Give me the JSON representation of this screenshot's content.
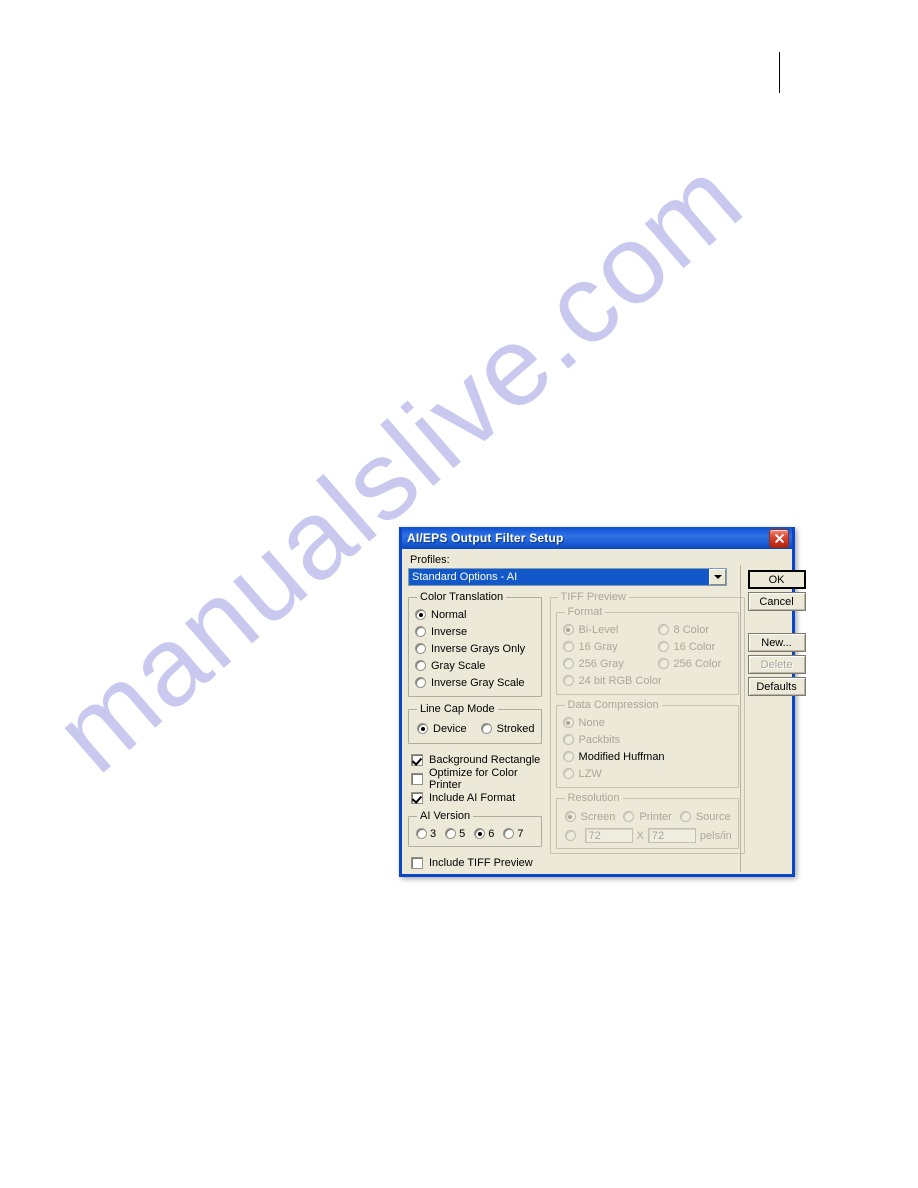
{
  "page": {
    "watermark_text": "manualslive.com",
    "watermark_color": "#c9c9ef",
    "margin_mark": "vertical-rule"
  },
  "dialog": {
    "title": "AI/EPS Output Filter Setup",
    "titlebar_color": "#1356d6",
    "face_color": "#ece9d8",
    "close_icon": "close-icon",
    "profiles": {
      "label": "Profiles:",
      "selected": "Standard Options - AI",
      "options": [
        "Standard Options - AI"
      ],
      "dropdown_icon": "chevron-down-icon"
    },
    "color_translation": {
      "legend": "Color Translation",
      "selected": "Normal",
      "options": [
        {
          "label": "Normal",
          "checked": true
        },
        {
          "label": "Inverse",
          "checked": false
        },
        {
          "label": "Inverse Grays Only",
          "checked": false
        },
        {
          "label": "Gray Scale",
          "checked": false
        },
        {
          "label": "Inverse Gray Scale",
          "checked": false
        }
      ]
    },
    "line_cap_mode": {
      "legend": "Line Cap Mode",
      "selected": "Device",
      "options": [
        {
          "label": "Device",
          "checked": true
        },
        {
          "label": "Stroked",
          "checked": false
        }
      ]
    },
    "checkboxes": [
      {
        "label": "Background Rectangle",
        "checked": true
      },
      {
        "label": "Optimize for Color Printer",
        "checked": false
      },
      {
        "label": "Include AI Format",
        "checked": true
      }
    ],
    "ai_version": {
      "legend": "AI Version",
      "selected": "6",
      "options": [
        {
          "label": "3",
          "checked": false
        },
        {
          "label": "5",
          "checked": false
        },
        {
          "label": "6",
          "checked": true
        },
        {
          "label": "7",
          "checked": false
        }
      ]
    },
    "include_tiff_preview": {
      "label": "Include TIFF Preview",
      "checked": false
    },
    "tiff_preview": {
      "legend": "TIFF Preview",
      "enabled": false,
      "format": {
        "legend": "Format",
        "selected": "Bi-Level",
        "options": [
          {
            "label": "Bi-Level",
            "checked": true
          },
          {
            "label": "8 Color",
            "checked": false
          },
          {
            "label": "16 Gray",
            "checked": false
          },
          {
            "label": "16 Color",
            "checked": false
          },
          {
            "label": "256 Gray",
            "checked": false
          },
          {
            "label": "256 Color",
            "checked": false
          },
          {
            "label": "24 bit RGB Color",
            "checked": false
          }
        ]
      },
      "data_compression": {
        "legend": "Data Compression",
        "selected": "None",
        "options": [
          {
            "label": "None",
            "checked": true
          },
          {
            "label": "Packbits",
            "checked": false
          },
          {
            "label": "Modified Huffman",
            "checked": false
          },
          {
            "label": "LZW",
            "checked": false
          }
        ]
      },
      "resolution": {
        "legend": "Resolution",
        "selected": "Screen",
        "options": [
          {
            "label": "Screen",
            "checked": true
          },
          {
            "label": "Printer",
            "checked": false
          },
          {
            "label": "Source",
            "checked": false
          }
        ],
        "custom": {
          "checked": false,
          "width": "72",
          "separator": "X",
          "height": "72",
          "units": "pels/in"
        }
      }
    },
    "buttons": [
      {
        "label": "OK",
        "state": "default"
      },
      {
        "label": "Cancel",
        "state": "normal"
      },
      {
        "label": "New...",
        "state": "normal"
      },
      {
        "label": "Delete",
        "state": "disabled"
      },
      {
        "label": "Defaults",
        "state": "normal"
      }
    ]
  }
}
